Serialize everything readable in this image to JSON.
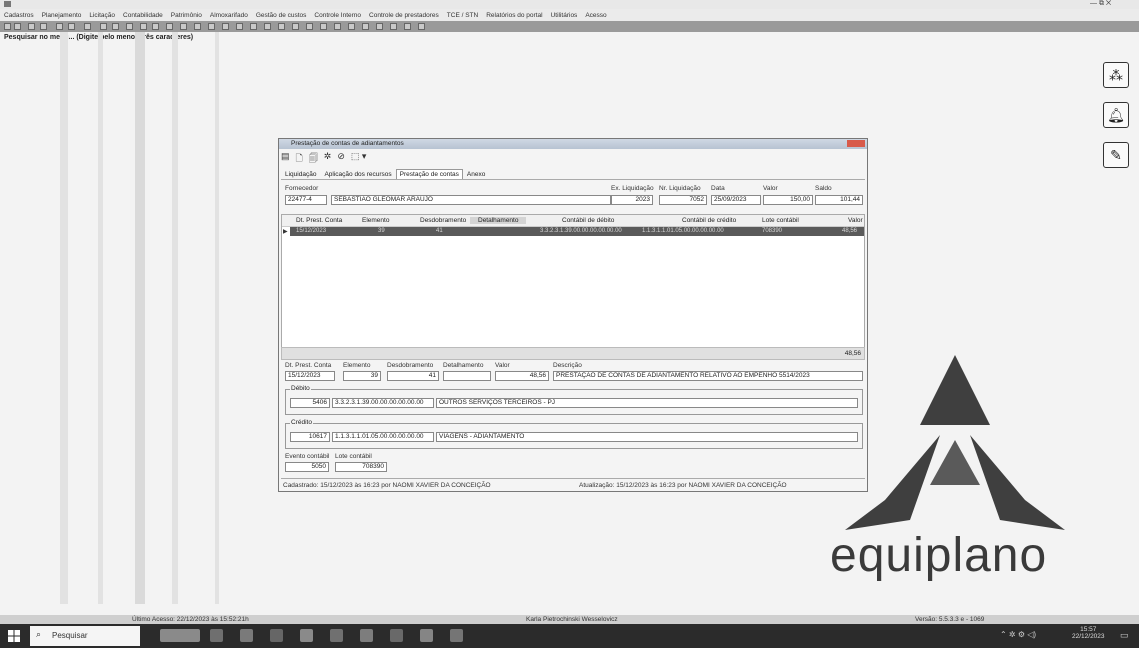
{
  "window": {
    "controls": "— ⧉ ✕"
  },
  "menu": [
    "Cadastros",
    "Planejamento",
    "Licitação",
    "Contabilidade",
    "Patrimônio",
    "Almoxarifado",
    "Gestão de custos",
    "Controle Interno",
    "Controle de prestadores",
    "TCE / STN",
    "Relatórios do portal",
    "Utilitários",
    "Acesso"
  ],
  "search_hint": "Pesquisar no menu... (Digite pelo menos três caracteres)",
  "side_icons": [
    "network-icon",
    "bell-icon",
    "edit-icon"
  ],
  "dialog": {
    "title": "Prestação de contas de adiantamentos",
    "toolbar_glyphs": [
      "▤",
      "🗋",
      "🗐",
      "✲",
      "⊘",
      "⬚ ▾"
    ],
    "tabs": [
      "Liquidação",
      "Aplicação dos recursos",
      "Prestação de contas",
      "Anexo"
    ],
    "header": {
      "fornecedor_label": "Fornecedor",
      "fornecedor_code": "22477-4",
      "fornecedor_name": "SEBASTIAO GLEOMAR ARAUJO",
      "ex_liq_label": "Ex. Liquidação",
      "ex_liq_value": "2023",
      "nr_liq_label": "Nr. Liquidação",
      "nr_liq_value": "7052",
      "data_label": "Data",
      "data_value": "25/09/2023",
      "valor_label": "Valor",
      "valor_value": "150,00",
      "saldo_label": "Saldo",
      "saldo_value": "101,44"
    },
    "grid": {
      "columns": [
        "Dt. Prest. Conta",
        "Elemento",
        "Desdobramento",
        "Detalhamento",
        "Contábil de débito",
        "Contábil de crédito",
        "Lote contábil",
        "Valor"
      ],
      "row": [
        "15/12/2023",
        "39",
        "41",
        "",
        "3.3.2.3.1.39.00.00.00.00.00.00",
        "1.1.3.1.1.01.05.00.00.00.00.00",
        "708390",
        "48,56"
      ],
      "total": "48,56"
    },
    "form": {
      "dt_label": "Dt. Prest. Conta",
      "dt_value": "15/12/2023",
      "elemento_label": "Elemento",
      "elemento_value": "39",
      "desdob_label": "Desdobramento",
      "desdob_value": "41",
      "detalh_label": "Detalhamento",
      "valor_label": "Valor",
      "valor_value": "48,56",
      "descricao_label": "Descrição",
      "descricao_value": "PRESTAÇÃO DE CONTAS DE ADIANTAMENTO RELATIVO AO EMPENHO 5514/2023",
      "debito_label": "Débito",
      "debito_code": "5406",
      "debito_account": "3.3.2.3.1.39.00.00.00.00.00.00",
      "debito_desc": "OUTROS SERVIÇOS TERCEIROS - PJ",
      "credito_label": "Crédito",
      "credito_code": "10617",
      "credito_account": "1.1.3.1.1.01.05.00.00.00.00.00",
      "credito_desc": "VIAGENS - ADIANTAMENTO",
      "evento_label": "Evento contábil",
      "evento_value": "5050",
      "lote_label": "Lote contábil",
      "lote_value": "708390"
    },
    "status": {
      "cadastrado": "Cadastrado: 15/12/2023 às 16:23 por NAOMI XAVIER DA CONCEIÇÃO",
      "atualizacao": "Atualização: 15/12/2023 às 16:23 por NAOMI XAVIER DA CONCEIÇÃO"
    }
  },
  "logo_text": "equiplano",
  "infobar": {
    "ultimo_acesso": "Último Acesso: 22/12/2023 às 15:52:21h",
    "user": "Karla Pietrochinski Wesselovicz",
    "versao": "Versão: 5.5.3.3 e - 1069"
  },
  "taskbar": {
    "search_placeholder": "Pesquisar",
    "clock_time": "15:57",
    "clock_date": "22/12/2023"
  }
}
